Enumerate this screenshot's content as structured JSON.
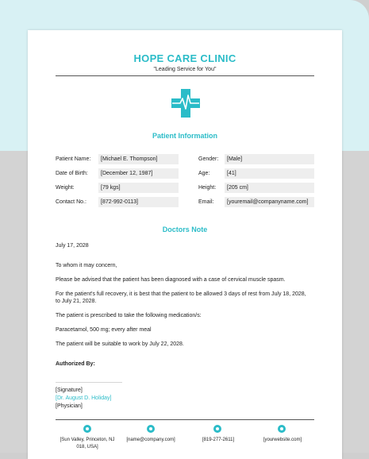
{
  "clinic": {
    "name": "HOPE CARE CLINIC",
    "tagline": "\"Leading Service for You\""
  },
  "icons": {
    "logo": "medical-cross-heartbeat-icon",
    "accent": "#2bbcc8"
  },
  "patient_info": {
    "title": "Patient Information",
    "left": [
      {
        "label": "Patient Name:",
        "value": "[Michael E. Thompson]"
      },
      {
        "label": "Date of Birth:",
        "value": "[December 12, 1987]"
      },
      {
        "label": "Weight:",
        "value": "[79 kgs]"
      },
      {
        "label": "Contact No.:",
        "value": "[872-992-0113]"
      }
    ],
    "right": [
      {
        "label": "Gender:",
        "value": "[Male]"
      },
      {
        "label": "Age:",
        "value": "[41]"
      },
      {
        "label": "Height:",
        "value": "[205 cm]"
      },
      {
        "label": "Email:",
        "value": "[youremail@companyname.com]"
      }
    ]
  },
  "doctors_note": {
    "title": "Doctors Note",
    "date": "July 17, 2028",
    "salutation": "To whom it may concern,",
    "p1": "Please be advised that the patient has been diagnosed with a case of cervical muscle spasm.",
    "p2a": "For the patient's full recovery, it is best that the patient to be allowed 3 days of rest from July 18, 2028,",
    "p2b": "to July 21, 2028.",
    "p3": "The patient is prescribed to take the following medication/s:",
    "p4": "Paracetamol, 500 mg; every after meal",
    "p5": "The patient will be suitable to work by July 22, 2028.",
    "authorized": "Authorized By:"
  },
  "signature": {
    "sig": "[Signature]",
    "name": "[Dr. August D. Holiday]",
    "role": "[Physician]"
  },
  "footer": {
    "address1": "[Sun Valley, Princeton, NJ",
    "address2": "018, USA]",
    "email": "[name@company.com]",
    "phone": "[819-277-2611]",
    "website": "[yourwebsite.com]"
  }
}
